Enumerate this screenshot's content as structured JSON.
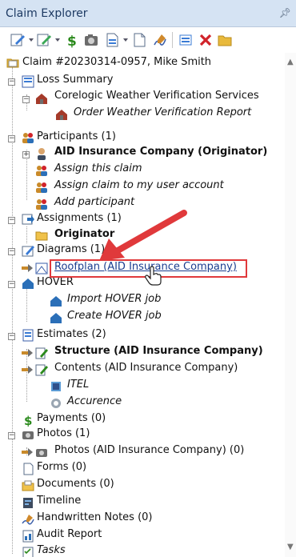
{
  "window": {
    "title": "Claim Explorer",
    "pin_icon": "pin-icon"
  },
  "toolbar": {
    "buttons": [
      "edit-icon",
      "edit-alt-icon",
      "payment-icon",
      "photo-icon",
      "document-icon",
      "new-document-icon",
      "signature-icon",
      "move-icon",
      "delete-icon",
      "folder-icon"
    ]
  },
  "tree": {
    "root": "Claim #20230314-0957, Mike Smith",
    "loss_summary": "Loss Summary",
    "corelogic": "Corelogic Weather Verification Services",
    "order_weather": "Order Weather Verification Report",
    "participants": "Participants (1)",
    "aid_originator": "AID Insurance Company (Originator)",
    "assign_claim": "Assign this claim",
    "assign_to_me": "Assign claim to my user account",
    "add_participant": "Add participant",
    "assignments": "Assignments (1)",
    "originator": "Originator",
    "diagrams": "Diagrams (1)",
    "roofplan": "Roofplan (AID Insurance Company)",
    "hover": "HOVER",
    "import_hover": "Import HOVER job",
    "create_hover": "Create HOVER job",
    "estimates": "Estimates (2)",
    "structure": "Structure (AID Insurance Company)",
    "contents": "Contents (AID Insurance Company)",
    "itel": "ITEL",
    "accurence": "Accurence",
    "payments": "Payments (0)",
    "photos": "Photos (1)",
    "photos_aid": "Photos (AID Insurance Company) (0)",
    "forms": "Forms (0)",
    "documents": "Documents (0)",
    "timeline": "Timeline",
    "handwritten": "Handwritten Notes (0)",
    "audit": "Audit Report",
    "tasks": "Tasks"
  },
  "colors": {
    "title_bar": "#d5e3f3",
    "highlight": "#e0393b",
    "link": "#1a3d8f"
  }
}
